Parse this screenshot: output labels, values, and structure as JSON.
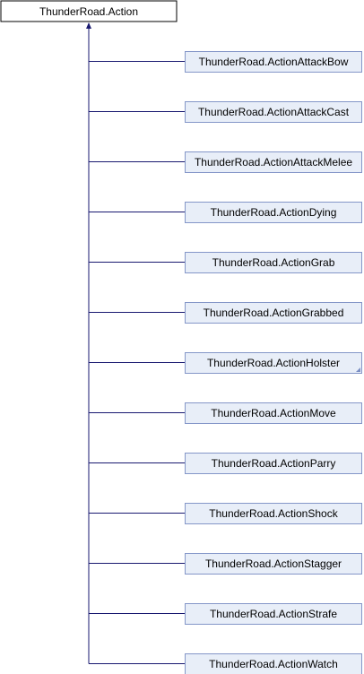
{
  "diagram": {
    "base_class": {
      "label": "ThunderRoad.Action"
    },
    "derived_classes": [
      {
        "label": "ThunderRoad.ActionAttackBow",
        "has_more_indicator": false
      },
      {
        "label": "ThunderRoad.ActionAttackCast",
        "has_more_indicator": false
      },
      {
        "label": "ThunderRoad.ActionAttackMelee",
        "has_more_indicator": false
      },
      {
        "label": "ThunderRoad.ActionDying",
        "has_more_indicator": false
      },
      {
        "label": "ThunderRoad.ActionGrab",
        "has_more_indicator": false
      },
      {
        "label": "ThunderRoad.ActionGrabbed",
        "has_more_indicator": false
      },
      {
        "label": "ThunderRoad.ActionHolster",
        "has_more_indicator": true
      },
      {
        "label": "ThunderRoad.ActionMove",
        "has_more_indicator": false
      },
      {
        "label": "ThunderRoad.ActionParry",
        "has_more_indicator": false
      },
      {
        "label": "ThunderRoad.ActionShock",
        "has_more_indicator": false
      },
      {
        "label": "ThunderRoad.ActionStagger",
        "has_more_indicator": false
      },
      {
        "label": "ThunderRoad.ActionStrafe",
        "has_more_indicator": false
      },
      {
        "label": "ThunderRoad.ActionWatch",
        "has_more_indicator": false
      }
    ],
    "colors": {
      "edge": "#191970",
      "base_fill": "#ffffff",
      "base_border": "#000000",
      "node_fill": "#e8eef8",
      "node_border": "#8496c8",
      "more_indicator": "#7b8fc4"
    }
  }
}
